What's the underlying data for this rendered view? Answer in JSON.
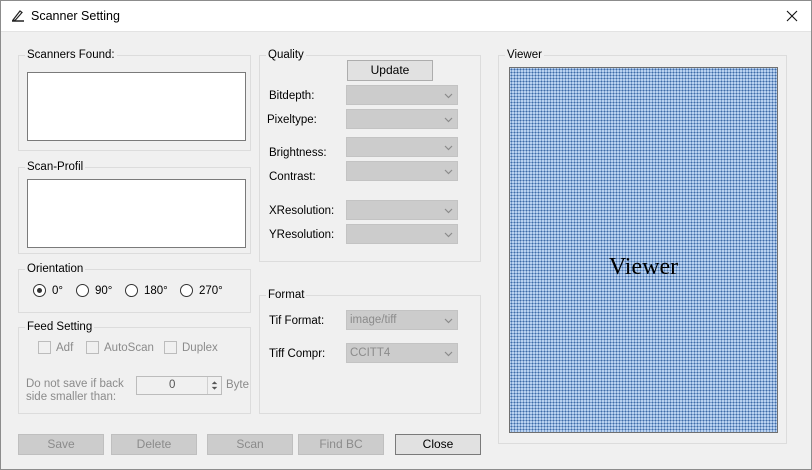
{
  "window": {
    "title": "Scanner Setting"
  },
  "scanners_found": {
    "label": "Scanners Found:"
  },
  "scan_profil": {
    "label": "Scan-Profil"
  },
  "orientation": {
    "label": "Orientation",
    "options": [
      "0°",
      "90°",
      "180°",
      "270°"
    ],
    "selected": "0°"
  },
  "feed_setting": {
    "label": "Feed Setting",
    "adf": "Adf",
    "autoscan": "AutoScan",
    "duplex": "Duplex",
    "skip_label_line1": "Do not save if back",
    "skip_label_line2": "side smaller than:",
    "skip_value": "0",
    "skip_unit": "Byte"
  },
  "quality": {
    "label": "Quality",
    "update_button": "Update",
    "bitdepth": "Bitdepth:",
    "pixeltype": "Pixeltype:",
    "brightness": "Brightness:",
    "contrast": "Contrast:",
    "xresolution": "XResolution:",
    "yresolution": "YResolution:"
  },
  "format": {
    "label": "Format",
    "tif_format_label": "Tif Format:",
    "tif_format_value": "image/tiff",
    "tiff_compr_label": "Tiff Compr:",
    "tiff_compr_value": "CCITT4"
  },
  "viewer": {
    "label": "Viewer",
    "placeholder": "Viewer"
  },
  "buttons": {
    "save": "Save",
    "delete": "Delete",
    "scan": "Scan",
    "find_bc": "Find BC",
    "close": "Close"
  }
}
